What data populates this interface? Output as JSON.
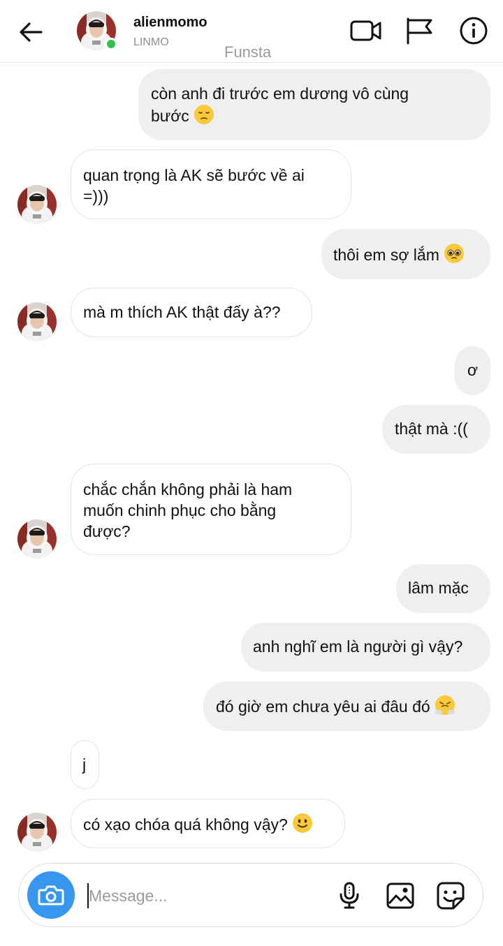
{
  "header": {
    "username": "alienmomo",
    "subtitle": "LINMO",
    "account_tag": "Funsta"
  },
  "messages": [
    {
      "side": "out",
      "lines": [
        "còn anh đi trước em dương vô cùng",
        "bước"
      ],
      "emoji": "pensive-face"
    },
    {
      "side": "in",
      "lines": [
        "quan trọng là AK sẽ bước về ai",
        "=)))"
      ]
    },
    {
      "side": "out",
      "lines": [
        "thôi em sợ lắm"
      ],
      "emoji": "pleading-face"
    },
    {
      "side": "in",
      "lines": [
        "mà m thích AK thật đấy à??"
      ]
    },
    {
      "side": "out",
      "lines": [
        "ơ"
      ]
    },
    {
      "side": "out",
      "lines": [
        "thật mà :(("
      ]
    },
    {
      "side": "in",
      "lines": [
        "chắc chắn không phải là ham",
        "muốn chinh phục cho bằng",
        "được?"
      ]
    },
    {
      "side": "out",
      "lines": [
        "lâm mặc"
      ]
    },
    {
      "side": "out",
      "lines": [
        "anh nghĩ em là người gì vậy?"
      ]
    },
    {
      "side": "out",
      "lines": [
        "đó giờ em chưa yêu ai đâu đó"
      ],
      "emoji": "face-with-steam-from-nose"
    },
    {
      "side": "in",
      "lines": [
        "j"
      ]
    },
    {
      "side": "in",
      "lines": [
        "có xạo chóa quá không vậy?"
      ],
      "emoji": "slightly-smiling-face"
    }
  ],
  "composer": {
    "placeholder": "Message...",
    "value": ""
  },
  "icons": {
    "back": "back-arrow-icon",
    "video": "video-call-icon",
    "report": "flag-icon",
    "info": "info-icon",
    "camera": "camera-icon",
    "mic": "microphone-icon",
    "gallery": "gallery-icon",
    "sticker": "sticker-icon"
  },
  "colors": {
    "outgoing_bubble": "#efefef",
    "incoming_border": "#e3e3e3",
    "camera_button": "#3797f0",
    "online_dot": "#2dc44c"
  }
}
